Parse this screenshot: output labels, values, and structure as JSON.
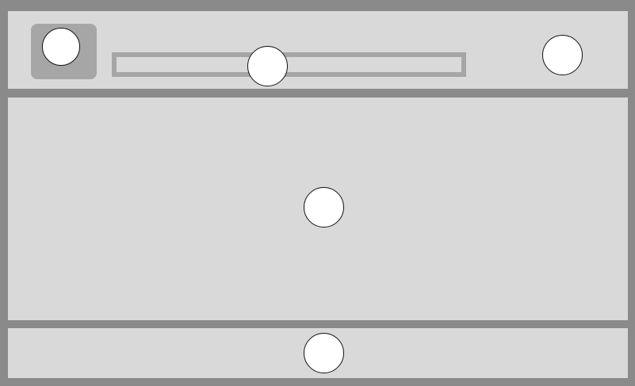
{
  "colors": {
    "frame": "#8a8a8a",
    "panel": "#d9d9d9",
    "accent_box": "#a6a6a6",
    "marker_fill": "#ffffff",
    "marker_stroke": "#111111"
  },
  "regions": [
    "header",
    "main",
    "footer"
  ],
  "markers": [
    {
      "region": "header",
      "target": "logo"
    },
    {
      "region": "header",
      "target": "search-bar"
    },
    {
      "region": "header",
      "target": "right-action"
    },
    {
      "region": "main",
      "target": "content"
    },
    {
      "region": "footer",
      "target": "footer"
    }
  ]
}
